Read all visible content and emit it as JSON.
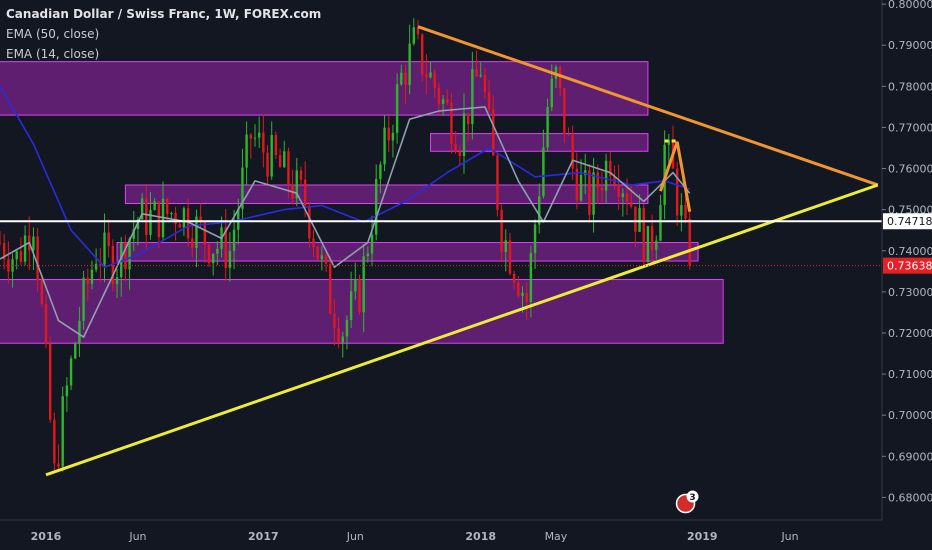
{
  "legend": {
    "title": "Canadian Dollar / Swiss Franc, 1W, FOREX.com",
    "ema50": "EMA (50, close)",
    "ema14": "EMA (14, close)"
  },
  "colors": {
    "background": "#131722",
    "up_candle": "#2fb52f",
    "down_candle": "#e1181d",
    "zone_fill": "#9c27b0",
    "zone_border": "#e040fb",
    "ema50": "#2a2ae0",
    "ema14": "#8fa0b0",
    "upper_trendline": "#f0952f",
    "lower_trendline": "#eded38",
    "axis_text": "#b2b5be",
    "marker_white": "#ffffff",
    "marker_red": "#e52128"
  },
  "chart_data": {
    "type": "candlestick",
    "instrument": "Canadian Dollar / Swiss Franc",
    "timeframe": "1W",
    "ylim": [
      0.6745,
      0.801
    ],
    "xlim": [
      "2015-10-19",
      "2019-11-04"
    ],
    "y_ticks": [
      "0.80000",
      "0.79000",
      "0.78000",
      "0.77000",
      "0.76000",
      "0.75000",
      "0.74000",
      "0.73000",
      "0.72000",
      "0.71000",
      "0.70000",
      "0.69000",
      "0.68000"
    ],
    "x_ticks": [
      {
        "label": "2016",
        "date": "2016-01-04",
        "bold": true
      },
      {
        "label": "Jun",
        "date": "2016-06-06",
        "bold": false
      },
      {
        "label": "2017",
        "date": "2017-01-02",
        "bold": true
      },
      {
        "label": "Jun",
        "date": "2017-06-05",
        "bold": false
      },
      {
        "label": "2018",
        "date": "2018-01-01",
        "bold": true
      },
      {
        "label": "May",
        "date": "2018-05-07",
        "bold": false
      },
      {
        "label": "2019",
        "date": "2019-01-07",
        "bold": true
      },
      {
        "label": "Jun",
        "date": "2019-06-03",
        "bold": false
      }
    ],
    "ohlc_anchors": [
      {
        "date": "2015-10-19",
        "close": 0.742
      },
      {
        "date": "2015-11-16",
        "close": 0.738
      },
      {
        "date": "2015-12-14",
        "close": 0.748
      },
      {
        "date": "2015-12-28",
        "close": 0.725
      },
      {
        "date": "2016-01-18",
        "close": 0.685
      },
      {
        "date": "2016-02-01",
        "close": 0.7
      },
      {
        "date": "2016-02-29",
        "close": 0.724
      },
      {
        "date": "2016-03-28",
        "close": 0.74
      },
      {
        "date": "2016-05-02",
        "close": 0.737
      },
      {
        "date": "2016-06-06",
        "close": 0.748
      },
      {
        "date": "2016-07-04",
        "close": 0.748
      },
      {
        "date": "2016-08-15",
        "close": 0.75
      },
      {
        "date": "2016-10-03",
        "close": 0.742
      },
      {
        "date": "2016-11-07",
        "close": 0.74
      },
      {
        "date": "2016-12-12",
        "close": 0.768
      },
      {
        "date": "2017-01-30",
        "close": 0.76
      },
      {
        "date": "2017-03-13",
        "close": 0.752
      },
      {
        "date": "2017-04-24",
        "close": 0.728
      },
      {
        "date": "2017-05-15",
        "close": 0.721
      },
      {
        "date": "2017-06-12",
        "close": 0.73
      },
      {
        "date": "2017-07-17",
        "close": 0.76
      },
      {
        "date": "2017-08-21",
        "close": 0.782
      },
      {
        "date": "2017-09-11",
        "close": 0.79
      },
      {
        "date": "2017-10-16",
        "close": 0.78
      },
      {
        "date": "2017-11-27",
        "close": 0.768
      },
      {
        "date": "2018-01-01",
        "close": 0.785
      },
      {
        "date": "2018-02-05",
        "close": 0.745
      },
      {
        "date": "2018-03-19",
        "close": 0.728
      },
      {
        "date": "2018-04-23",
        "close": 0.775
      },
      {
        "date": "2018-05-07",
        "close": 0.782
      },
      {
        "date": "2018-06-04",
        "close": 0.76
      },
      {
        "date": "2018-07-02",
        "close": 0.752
      },
      {
        "date": "2018-08-06",
        "close": 0.763
      },
      {
        "date": "2018-09-03",
        "close": 0.755
      },
      {
        "date": "2018-10-08",
        "close": 0.74
      },
      {
        "date": "2018-10-22",
        "close": 0.747
      },
      {
        "date": "2018-11-05",
        "close": 0.765
      },
      {
        "date": "2018-11-19",
        "close": 0.758
      },
      {
        "date": "2018-12-03",
        "close": 0.748
      },
      {
        "date": "2018-12-17",
        "close": 0.7364
      }
    ],
    "zones": [
      {
        "x0": "2015-10-12",
        "x1": "2018-10-08",
        "y0": 0.773,
        "y1": 0.786
      },
      {
        "x0": "2017-10-09",
        "x1": "2018-10-08",
        "y0": 0.7642,
        "y1": 0.7685
      },
      {
        "x0": "2016-05-16",
        "x1": "2018-10-08",
        "y0": 0.7515,
        "y1": 0.756
      },
      {
        "x0": "2016-05-02",
        "x1": "2018-12-31",
        "y0": 0.7375,
        "y1": 0.742
      },
      {
        "x0": "2015-10-12",
        "x1": "2019-02-11",
        "y0": 0.7175,
        "y1": 0.733
      }
    ],
    "trendlines": [
      {
        "name": "upper",
        "from": {
          "date": "2017-09-18",
          "price": 0.7945
        },
        "to": {
          "date": "2019-10-28",
          "price": 0.756
        }
      },
      {
        "name": "lower",
        "from": {
          "date": "2016-01-04",
          "price": 0.6855
        },
        "to": {
          "date": "2019-10-28",
          "price": 0.756
        }
      }
    ],
    "pattern_lines": [
      {
        "points": [
          {
            "date": "2018-10-29",
            "price": 0.7545
          },
          {
            "date": "2018-11-26",
            "price": 0.7665
          },
          {
            "date": "2018-12-17",
            "price": 0.7495
          }
        ]
      }
    ],
    "pattern_dashes": [
      {
        "from": {
          "date": "2018-11-05",
          "price": 0.7667
        },
        "to": {
          "date": "2018-11-26",
          "price": 0.7667
        }
      }
    ],
    "horizontal_lines": [
      {
        "price": 0.74718,
        "label": "0.74718",
        "style": "solid"
      },
      {
        "price": 0.73638,
        "label": "0.73638",
        "style": "dotted"
      }
    ],
    "series": [
      {
        "name": "EMA (50, close)",
        "points": [
          {
            "date": "2015-10-19",
            "value": 0.78
          },
          {
            "date": "2015-12-14",
            "value": 0.766
          },
          {
            "date": "2016-02-15",
            "value": 0.745
          },
          {
            "date": "2016-04-11",
            "value": 0.736
          },
          {
            "date": "2016-06-06",
            "value": 0.739
          },
          {
            "date": "2016-08-29",
            "value": 0.746
          },
          {
            "date": "2016-11-07",
            "value": 0.747
          },
          {
            "date": "2017-02-06",
            "value": 0.75
          },
          {
            "date": "2017-04-10",
            "value": 0.751
          },
          {
            "date": "2017-06-19",
            "value": 0.747
          },
          {
            "date": "2017-08-28",
            "value": 0.752
          },
          {
            "date": "2017-11-06",
            "value": 0.759
          },
          {
            "date": "2018-01-15",
            "value": 0.765
          },
          {
            "date": "2018-04-02",
            "value": 0.758
          },
          {
            "date": "2018-06-18",
            "value": 0.759
          },
          {
            "date": "2018-09-10",
            "value": 0.756
          },
          {
            "date": "2018-11-05",
            "value": 0.757
          },
          {
            "date": "2018-12-17",
            "value": 0.755
          }
        ]
      },
      {
        "name": "EMA (14, close)",
        "points": [
          {
            "date": "2015-10-19",
            "value": 0.738
          },
          {
            "date": "2015-12-07",
            "value": 0.742
          },
          {
            "date": "2016-01-25",
            "value": 0.723
          },
          {
            "date": "2016-03-07",
            "value": 0.719
          },
          {
            "date": "2016-04-25",
            "value": 0.734
          },
          {
            "date": "2016-06-13",
            "value": 0.749
          },
          {
            "date": "2016-08-29",
            "value": 0.747
          },
          {
            "date": "2016-10-24",
            "value": 0.743
          },
          {
            "date": "2016-12-19",
            "value": 0.757
          },
          {
            "date": "2017-02-27",
            "value": 0.754
          },
          {
            "date": "2017-05-01",
            "value": 0.736
          },
          {
            "date": "2017-06-26",
            "value": 0.742
          },
          {
            "date": "2017-09-04",
            "value": 0.772
          },
          {
            "date": "2017-10-23",
            "value": 0.774
          },
          {
            "date": "2018-01-08",
            "value": 0.775
          },
          {
            "date": "2018-03-05",
            "value": 0.757
          },
          {
            "date": "2018-04-16",
            "value": 0.747
          },
          {
            "date": "2018-06-04",
            "value": 0.762
          },
          {
            "date": "2018-08-06",
            "value": 0.759
          },
          {
            "date": "2018-10-01",
            "value": 0.752
          },
          {
            "date": "2018-11-19",
            "value": 0.759
          },
          {
            "date": "2018-12-17",
            "value": 0.754
          }
        ]
      }
    ],
    "badge_text": "3"
  }
}
